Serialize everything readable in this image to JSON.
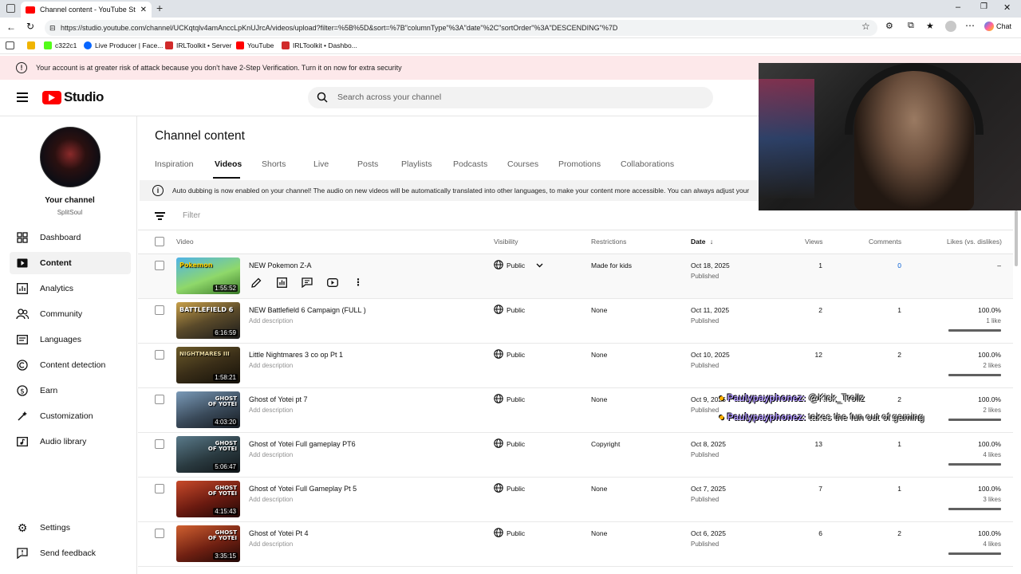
{
  "browser": {
    "tab_title": "Channel content - YouTube Studio",
    "url": "https://studio.youtube.com/channel/UCKqtqlv4amAnccLpKnUJrcA/videos/upload?filter=%5B%5D&sort=%7B\"columnType\"%3A\"date\"%2C\"sortOrder\"%3A\"DESCENDING\"%7D",
    "chat_label": "Chat",
    "bookmarks": [
      "c322c1",
      "Live Producer | Face...",
      "IRLToolkit • Server",
      "YouTube",
      "IRLToolkit • Dashbo..."
    ]
  },
  "security_banner": "Your account is at greater risk of attack because you don't have 2-Step Verification. Turn it on now for extra security",
  "header": {
    "logo_text": "Studio",
    "search_placeholder": "Search across your channel"
  },
  "sidebar": {
    "channel_title": "Your channel",
    "channel_name": "SplitSoul",
    "items": [
      {
        "label": "Dashboard",
        "icon": "dashboard-icon"
      },
      {
        "label": "Content",
        "icon": "content-icon"
      },
      {
        "label": "Analytics",
        "icon": "analytics-icon"
      },
      {
        "label": "Community",
        "icon": "community-icon"
      },
      {
        "label": "Languages",
        "icon": "languages-icon"
      },
      {
        "label": "Content detection",
        "icon": "copyright-icon"
      },
      {
        "label": "Earn",
        "icon": "earn-icon"
      },
      {
        "label": "Customization",
        "icon": "customization-icon"
      },
      {
        "label": "Audio library",
        "icon": "audio-library-icon"
      }
    ],
    "settings": "Settings",
    "feedback": "Send feedback"
  },
  "main": {
    "title": "Channel content",
    "tabs": [
      "Inspiration",
      "Videos",
      "Shorts",
      "Live",
      "Posts",
      "Playlists",
      "Podcasts",
      "Courses",
      "Promotions",
      "Collaborations"
    ],
    "active_tab": "Videos",
    "dubbing_notice": "Auto dubbing is now enabled on your channel! The audio on new videos will be automatically translated into other languages, to make your content more accessible. You can always adjust your",
    "filter_placeholder": "Filter",
    "columns": {
      "video": "Video",
      "visibility": "Visibility",
      "restrictions": "Restrictions",
      "date": "Date",
      "views": "Views",
      "comments": "Comments",
      "likes": "Likes (vs. dislikes)"
    },
    "rows": [
      {
        "title": "NEW Pokemon Z-A",
        "desc": "",
        "duration": "1:55:52",
        "thumb_text": "Pokemon",
        "visibility": "Public",
        "restrictions": "Made for kids",
        "date": "Oct 18, 2025",
        "status": "Published",
        "views": "1",
        "comments": "0",
        "likes": "–",
        "likes_sub": ""
      },
      {
        "title": "NEW Battlefield 6 Campaign (FULL )",
        "desc": "Add description",
        "duration": "6:16:59",
        "thumb_text": "BATTLEFIELD 6",
        "visibility": "Public",
        "restrictions": "None",
        "date": "Oct 11, 2025",
        "status": "Published",
        "views": "2",
        "comments": "1",
        "likes": "100.0%",
        "likes_sub": "1 like"
      },
      {
        "title": "Little Nightmares 3 co op Pt 1",
        "desc": "Add description",
        "duration": "1:58:21",
        "thumb_text": "NIGHTMARES III",
        "visibility": "Public",
        "restrictions": "None",
        "date": "Oct 10, 2025",
        "status": "Published",
        "views": "12",
        "comments": "2",
        "likes": "100.0%",
        "likes_sub": "2 likes"
      },
      {
        "title": "Ghost of Yotei pt 7",
        "desc": "Add description",
        "duration": "4:03:20",
        "thumb_text": "GHOST OF YOTEI",
        "visibility": "Public",
        "restrictions": "None",
        "date": "Oct 9, 2025",
        "status": "Published",
        "views": "",
        "comments": "2",
        "likes": "100.0%",
        "likes_sub": "2 likes"
      },
      {
        "title": "Ghost of Yotei Full gameplay PT6",
        "desc": "Add description",
        "duration": "5:06:47",
        "thumb_text": "GHOST OF YOTEI",
        "visibility": "Public",
        "restrictions": "Copyright",
        "date": "Oct 8, 2025",
        "status": "Published",
        "views": "13",
        "comments": "1",
        "likes": "100.0%",
        "likes_sub": "4 likes"
      },
      {
        "title": "Ghost of Yotei Full Gameplay Pt 5",
        "desc": "Add description",
        "duration": "4:15:43",
        "thumb_text": "GHOST OF YOTEI",
        "visibility": "Public",
        "restrictions": "None",
        "date": "Oct 7, 2025",
        "status": "Published",
        "views": "7",
        "comments": "1",
        "likes": "100.0%",
        "likes_sub": "3 likes"
      },
      {
        "title": "Ghost of Yotei Pt 4",
        "desc": "Add description",
        "duration": "3:35:15",
        "thumb_text": "GHOST OF YOTEI",
        "visibility": "Public",
        "restrictions": "None",
        "date": "Oct 6, 2025",
        "status": "Published",
        "views": "6",
        "comments": "2",
        "likes": "100.0%",
        "likes_sub": "4 likes"
      }
    ]
  },
  "stream_overlay": {
    "chat_messages": [
      {
        "user": "Paulypayphonez:",
        "text": "@Kick_Trollz"
      },
      {
        "user": "Paulypayphonez:",
        "text": "takes the fun out of gaming"
      }
    ]
  },
  "colors": {
    "brand_red": "#ff0000",
    "accent_blue": "#065fd4",
    "banner_pink": "#fde8ea"
  }
}
